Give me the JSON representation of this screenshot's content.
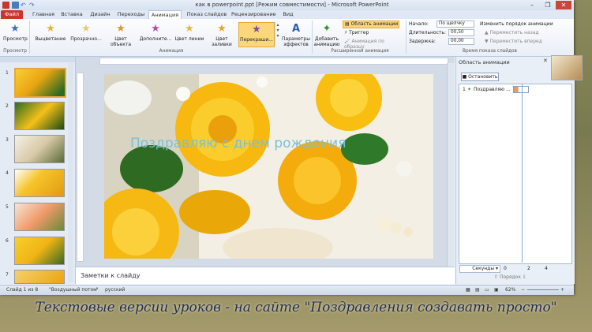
{
  "window": {
    "title": "как в powerpoint.ppt [Режим совместимости] - Microsoft PowerPoint",
    "controls": [
      "–",
      "❐",
      "✕"
    ]
  },
  "tabs": [
    "Файл",
    "Главная",
    "Вставка",
    "Дизайн",
    "Переходы",
    "Анимация",
    "Показ слайдов",
    "Рецензирование",
    "Вид"
  ],
  "ribbon": {
    "preview": {
      "label": "Просмотр",
      "group": "Просмотр"
    },
    "animation_gallery": [
      "Выцветание",
      "Прозрачно...",
      "Цвет объекта",
      "Дополните...",
      "Цвет линии",
      "Цвет заливки",
      "Перекраши..."
    ],
    "effects_button": "Параметры эффектов",
    "group_animation": "Анимация",
    "add_animation": "Добавить анимацию",
    "pane_button": "Область анимации",
    "trigger_button": "Триггер",
    "painter_button": "Анимация по образцу",
    "group_advanced": "Расширенная анимация",
    "start_label": "Начало:",
    "start_value": "По щелчку",
    "duration_label": "Длительность:",
    "duration_value": "00,50",
    "delay_label": "Задержка:",
    "delay_value": "00,00",
    "reorder_title": "Изменить порядок анимации",
    "move_earlier": "Переместить назад",
    "move_later": "Переместить вперед",
    "group_timing": "Время показа слайдов"
  },
  "thumbnails": [
    "1",
    "2",
    "3",
    "4",
    "5",
    "6",
    "7"
  ],
  "slide": {
    "text": "Поздравляю с днем рождения"
  },
  "notes_placeholder": "Заметки к слайду",
  "animation_pane": {
    "title": "Область анимации",
    "stop_button": "Остановить",
    "item_number": "1",
    "item_label": "Поздравляю ...",
    "seconds_label": "Секунды",
    "timeline": [
      "0",
      "2",
      "4"
    ],
    "reorder_label": "Порядок"
  },
  "status": {
    "slide": "Слайд 1 из 8",
    "theme": "\"Воздушный поток\"",
    "language": "русский",
    "zoom": "62%"
  },
  "caption": "Текстовые версии уроков - на сайте \"Поздравления создавать просто\"",
  "colors": {
    "file_tab": "#c8382a",
    "slide_text": "#79c0d8",
    "accent_selection": "#e7a640"
  }
}
